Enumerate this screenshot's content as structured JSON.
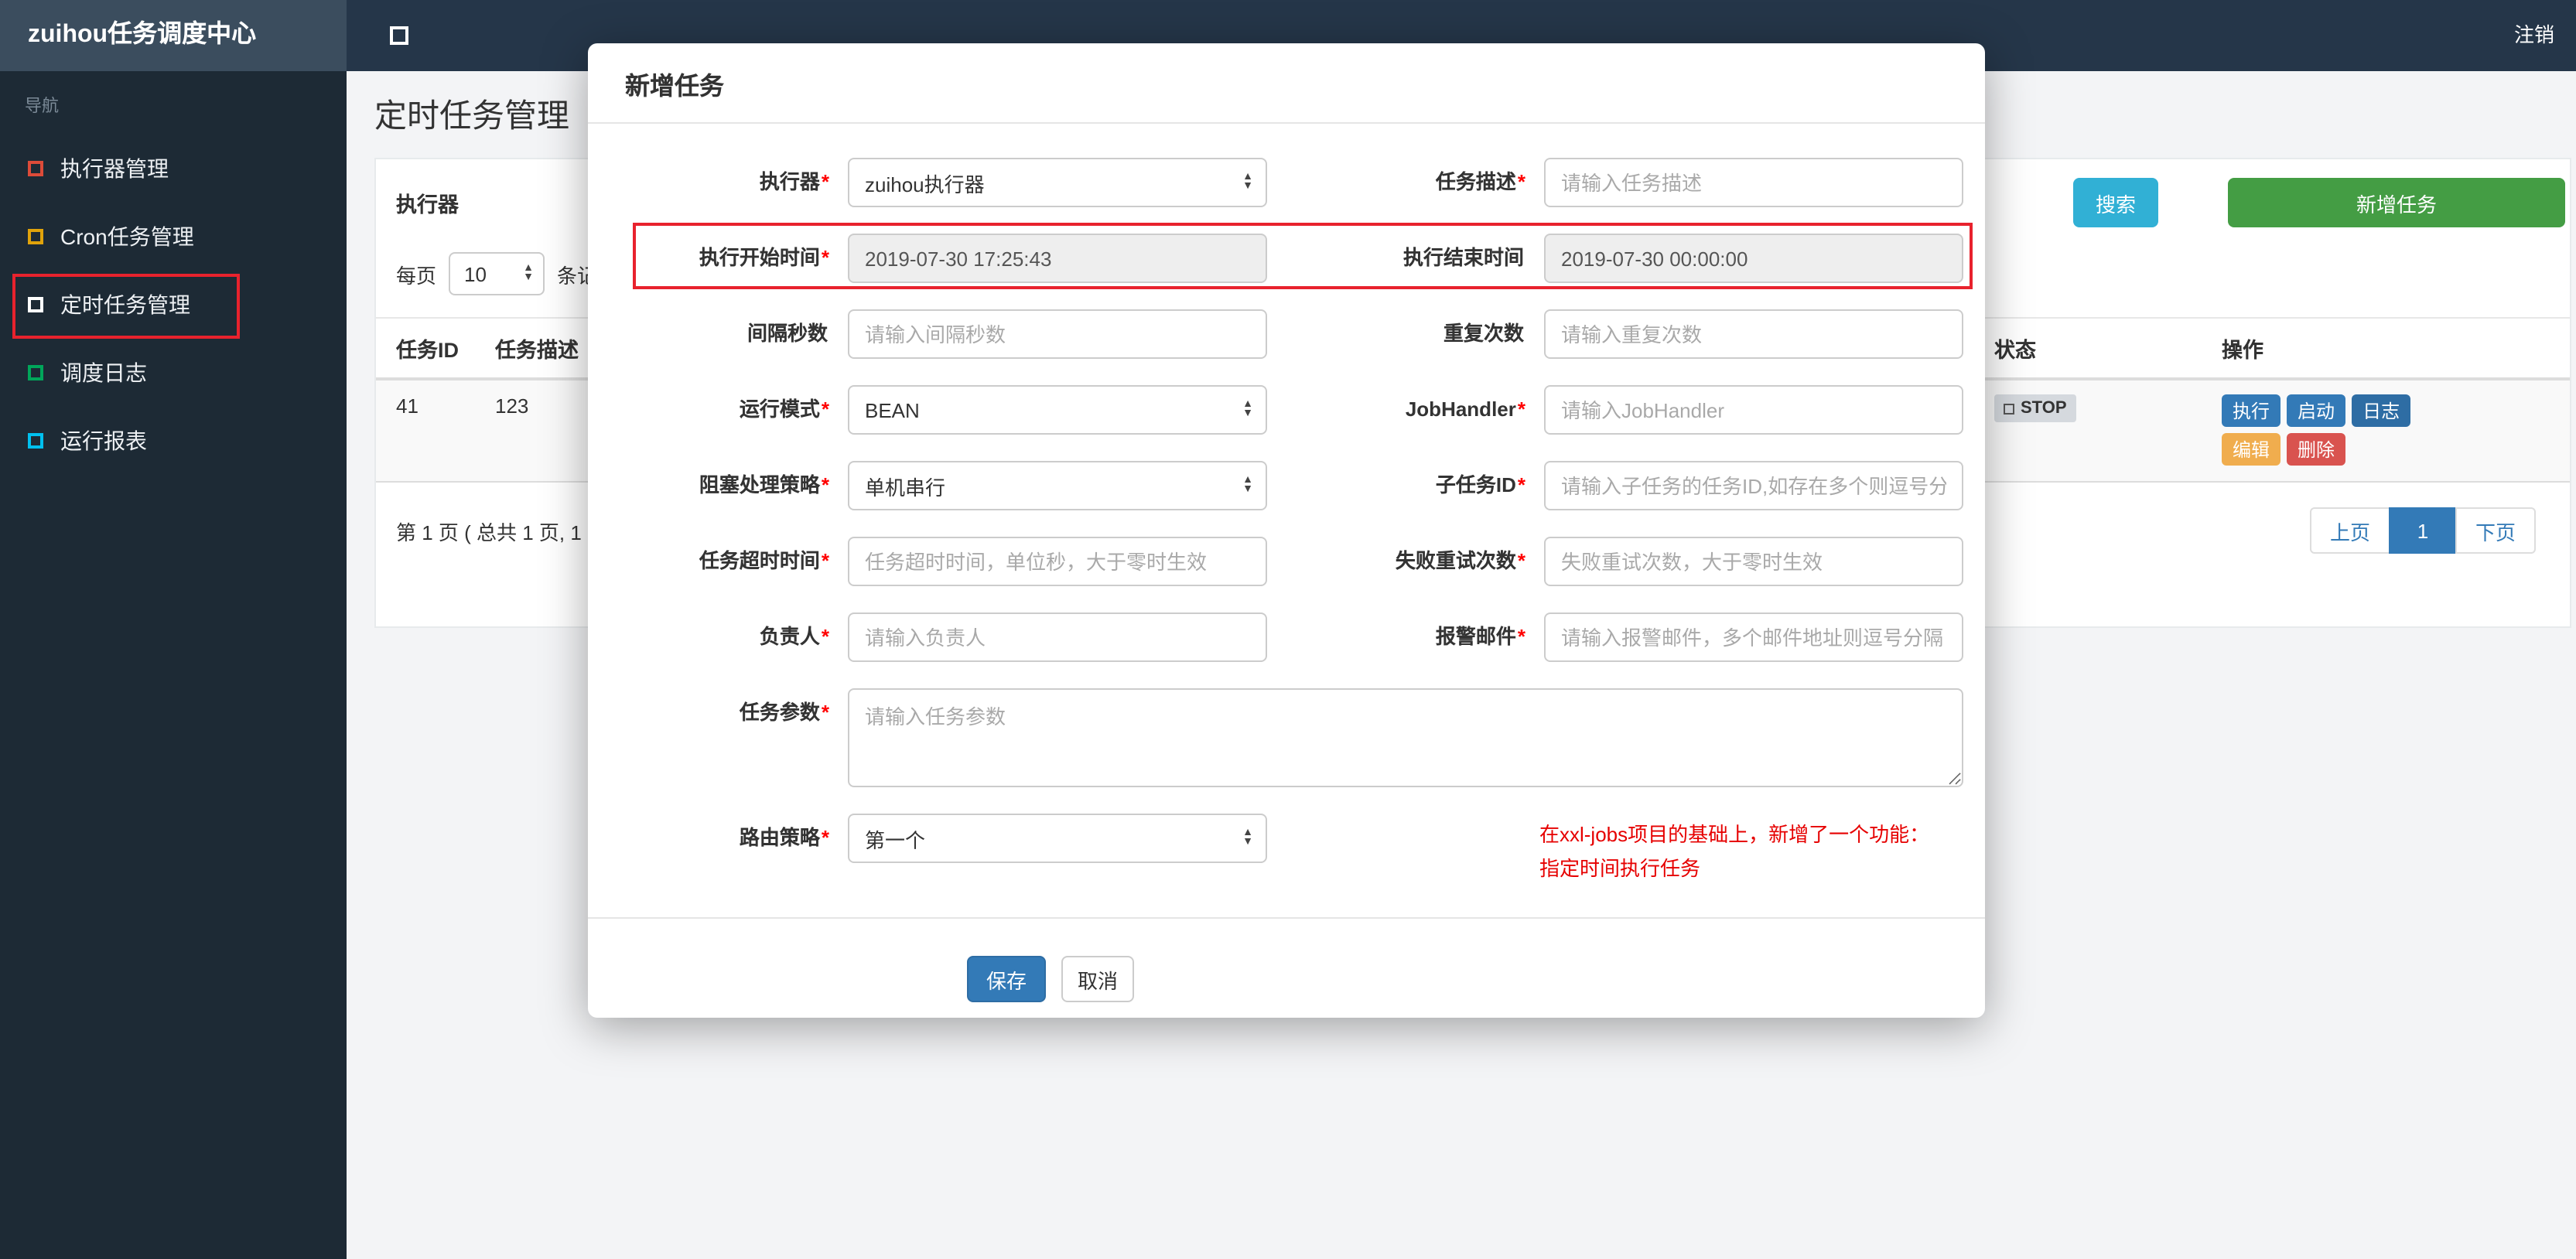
{
  "icons": {
    "caret_up": "▲",
    "caret_down": "▼"
  },
  "colors": {
    "accent_blue": "#337ab7",
    "accent_green": "#449d44",
    "accent_teal": "#31b0d5",
    "warning_orange": "#f0ad4e",
    "danger_red": "#d9534f",
    "annotation_red": "#e8222d"
  },
  "topbar": {
    "brand": "zuihou任务调度中心",
    "logout": "注销"
  },
  "sidebar": {
    "nav_label": "导航",
    "items": [
      {
        "label": "执行器管理",
        "color": "#dd4b39"
      },
      {
        "label": "Cron任务管理",
        "color": "#e0a30b"
      },
      {
        "label": "定时任务管理",
        "color": "#ffffff"
      },
      {
        "label": "调度日志",
        "color": "#00a65a"
      },
      {
        "label": "运行报表",
        "color": "#00c0ef"
      }
    ]
  },
  "page": {
    "title": "定时任务管理",
    "toolbar": {
      "filter_label": "执行器",
      "search": "搜索",
      "add": "新增任务"
    },
    "perpage": {
      "label": "每页",
      "value": "10",
      "suffix": "条记"
    },
    "table": {
      "headers": {
        "id": "任务ID",
        "desc": "任务描述",
        "status": "状态",
        "action": "操作"
      },
      "row": {
        "id": "41",
        "desc": "123",
        "status": "STOP",
        "btn_run": "执行",
        "btn_start": "启动",
        "btn_log": "日志",
        "btn_edit": "编辑",
        "btn_delete": "删除"
      }
    },
    "pagination": {
      "summary": "第 1 页 ( 总共 1 页, 1",
      "prev": "上页",
      "current": "1",
      "next": "下页"
    }
  },
  "modal": {
    "title": "新增任务",
    "rows": [
      {
        "left": {
          "label": "执行器",
          "star": "*",
          "value": "zuihou执行器"
        },
        "right": {
          "label": "任务描述",
          "star": "*",
          "placeholder": "请输入任务描述"
        }
      },
      {
        "left": {
          "label": "执行开始时间",
          "star": "*",
          "value": "2019-07-30 17:25:43"
        },
        "right": {
          "label": "执行结束时间",
          "star": "",
          "value": "2019-07-30 00:00:00"
        }
      },
      {
        "left": {
          "label": "间隔秒数",
          "star": "",
          "placeholder": "请输入间隔秒数"
        },
        "right": {
          "label": "重复次数",
          "star": "",
          "placeholder": "请输入重复次数"
        }
      },
      {
        "left": {
          "label": "运行模式",
          "star": "*",
          "value": "BEAN"
        },
        "right": {
          "label": "JobHandler",
          "star": "*",
          "placeholder": "请输入JobHandler"
        }
      },
      {
        "left": {
          "label": "阻塞处理策略",
          "star": "*",
          "value": "单机串行"
        },
        "right": {
          "label": "子任务ID",
          "star": "*",
          "placeholder": "请输入子任务的任务ID,如存在多个则逗号分隔"
        }
      },
      {
        "left": {
          "label": "任务超时时间",
          "star": "*",
          "placeholder": "任务超时时间，单位秒，大于零时生效"
        },
        "right": {
          "label": "失败重试次数",
          "star": "*",
          "placeholder": "失败重试次数，大于零时生效"
        }
      },
      {
        "left": {
          "label": "负责人",
          "star": "*",
          "placeholder": "请输入负责人"
        },
        "right": {
          "label": "报警邮件",
          "star": "*",
          "placeholder": "请输入报警邮件，多个邮件地址则逗号分隔"
        }
      }
    ],
    "param": {
      "label": "任务参数",
      "star": "*",
      "placeholder": "请输入任务参数"
    },
    "route": {
      "label": "路由策略",
      "star": "*",
      "value": "第一个"
    },
    "note": {
      "line1": "在xxl-jobs项目的基础上，新增了一个功能：",
      "line2": "指定时间执行任务"
    },
    "buttons": {
      "save": "保存",
      "cancel": "取消"
    }
  }
}
